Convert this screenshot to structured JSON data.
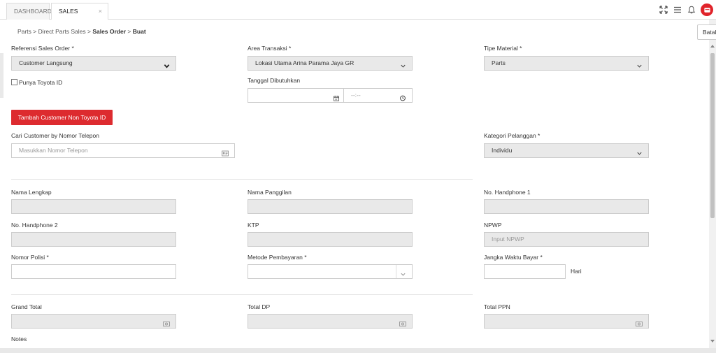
{
  "tabs": [
    {
      "label": "DASHBOARD"
    },
    {
      "label": "SALES ORDER",
      "close": "×"
    }
  ],
  "header_icons": [
    "expand-icon",
    "menu-icon",
    "bell-icon",
    "app-icon"
  ],
  "breadcrumb": {
    "parts": "Parts",
    "sep1": ">",
    "direct": "Direct Parts Sales",
    "sep2": ">",
    "sales_order": "Sales Order",
    "sep3": ">",
    "buat": "Buat"
  },
  "actions": {
    "batal_label": "Batal"
  },
  "form": {
    "referensi_label": "Referensi Sales Order *",
    "referensi_value": "Customer Langsung",
    "area_label": "Area Transaksi *",
    "area_value": "Lokasi Utama Arina Parama Jaya GR",
    "tipe_label": "Tipe Material *",
    "tipe_value": "Parts",
    "punya_toyota_label": "Punya Toyota ID",
    "tanggal_label": "Tanggal Dibutuhkan",
    "time_placeholder": "--:--",
    "tambah_button": "Tambah Customer Non Toyota ID",
    "cari_label": "Cari Customer by Nomor Telepon",
    "cari_placeholder": "Masukkan Nomor Telepon",
    "kategori_label": "Kategori Pelanggan *",
    "kategori_value": "Individu",
    "nama_lengkap_label": "Nama Lengkap",
    "nama_panggilan_label": "Nama Panggilan",
    "hp1_label": "No. Handphone 1",
    "hp2_label": "No. Handphone 2",
    "ktp_label": "KTP",
    "npwp_label": "NPWP",
    "npwp_placeholder": "Input NPWP",
    "nomor_polisi_label": "Nomor Polisi *",
    "metode_label": "Metode Pembayaran *",
    "jangka_label": "Jangka Waktu Bayar *",
    "hari_label": "Hari",
    "grand_total_label": "Grand Total",
    "total_dp_label": "Total DP",
    "total_ppn_label": "Total PPN",
    "notes_label": "Notes"
  },
  "colors": {
    "accent": "#dd2b2f",
    "field_disabled": "#e9e9e9",
    "border": "#cccccc"
  }
}
